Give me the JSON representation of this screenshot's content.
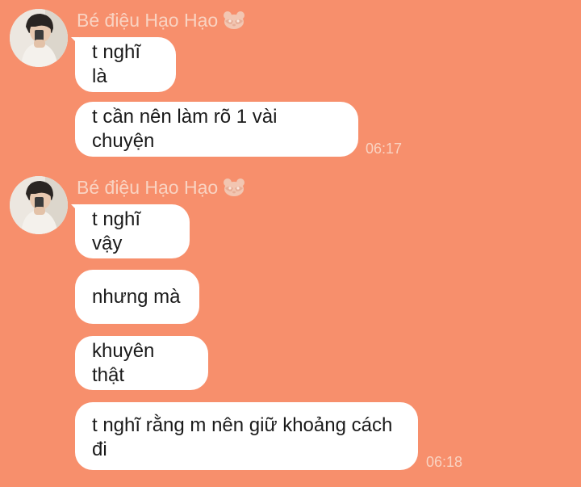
{
  "sender_name": "Bé điệu Hạo Hạo",
  "groups": [
    {
      "messages": [
        "t nghĩ là",
        "t cần nên làm rõ 1 vài chuyện"
      ],
      "time": "06:17"
    },
    {
      "messages": [
        "t nghĩ vậy",
        "nhưng mà",
        "khuyên thật",
        "t nghĩ rằng m nên giữ khoảng cách đi"
      ],
      "time": "06:18"
    }
  ],
  "icons": {
    "sender_emoji": "raccoon-icon"
  },
  "colors": {
    "background": "#F78F6C",
    "bubble": "#FFFFFF",
    "meta_text": "#F9D3C2"
  }
}
